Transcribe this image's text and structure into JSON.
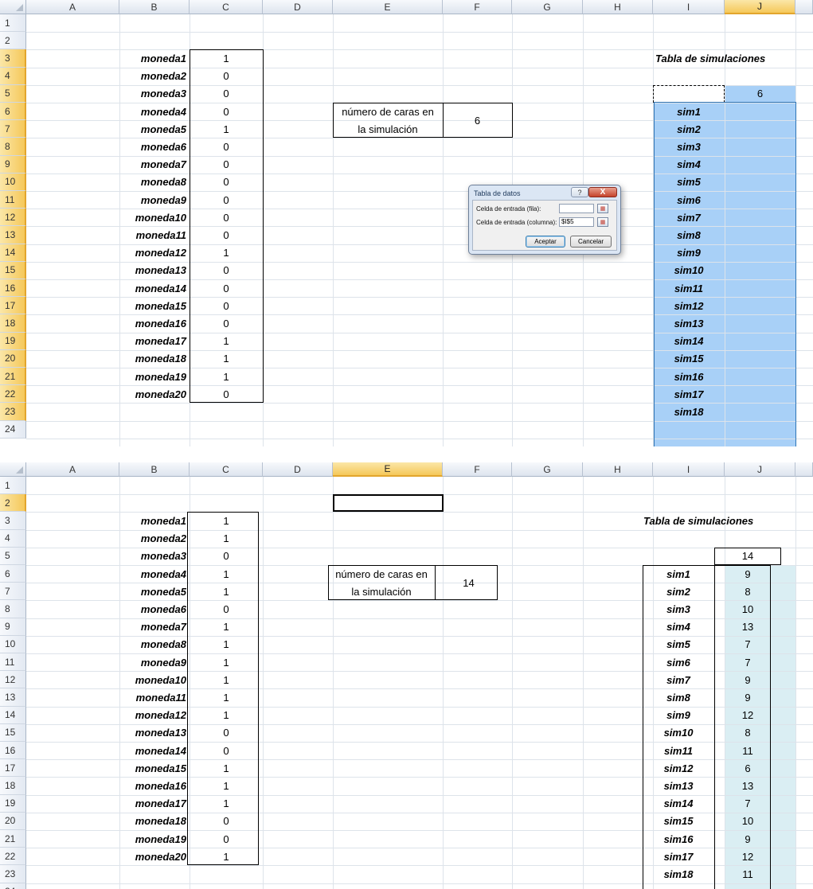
{
  "columns": [
    "A",
    "B",
    "C",
    "D",
    "E",
    "F",
    "G",
    "H",
    "I",
    "J"
  ],
  "row_numbers": [
    "1",
    "2",
    "3",
    "4",
    "5",
    "6",
    "7",
    "8",
    "9",
    "10",
    "11",
    "12",
    "13",
    "14",
    "15",
    "16",
    "17",
    "18",
    "19",
    "20",
    "21",
    "22",
    "23",
    "24"
  ],
  "label_box": {
    "line1": "número de caras en",
    "line2": "la simulación"
  },
  "sim_title": "Tabla de simulaciones",
  "coins": [
    "moneda1",
    "moneda2",
    "moneda3",
    "moneda4",
    "moneda5",
    "moneda6",
    "moneda7",
    "moneda8",
    "moneda9",
    "moneda10",
    "moneda11",
    "moneda12",
    "moneda13",
    "moneda14",
    "moneda15",
    "moneda16",
    "moneda17",
    "moneda18",
    "moneda19",
    "moneda20"
  ],
  "sims": [
    "sim1",
    "sim2",
    "sim3",
    "sim4",
    "sim5",
    "sim6",
    "sim7",
    "sim8",
    "sim9",
    "sim10",
    "sim11",
    "sim12",
    "sim13",
    "sim14",
    "sim15",
    "sim16",
    "sim17",
    "sim18"
  ],
  "sheet1": {
    "coin_values": [
      "1",
      "0",
      "0",
      "0",
      "1",
      "0",
      "0",
      "0",
      "0",
      "0",
      "0",
      "1",
      "0",
      "0",
      "0",
      "0",
      "1",
      "1",
      "1",
      "0"
    ],
    "heads_total": "6",
    "table_header": "6",
    "selected_column": "J",
    "selection_fill": "#a8d0f7",
    "dialog": {
      "title": "Tabla de datos",
      "help": "?",
      "close": "X",
      "row_input_label": "Celda de entrada (fila):",
      "row_input_value": "",
      "col_input_label": "Celda de entrada (columna):",
      "col_input_value": "$I$5",
      "ok": "Aceptar",
      "cancel": "Cancelar"
    }
  },
  "sheet2": {
    "coin_values": [
      "1",
      "1",
      "0",
      "1",
      "1",
      "0",
      "1",
      "1",
      "1",
      "1",
      "1",
      "1",
      "0",
      "0",
      "1",
      "1",
      "1",
      "0",
      "0",
      "1"
    ],
    "heads_total": "14",
    "table_header": "14",
    "sim_results": [
      "9",
      "8",
      "10",
      "13",
      "7",
      "7",
      "9",
      "9",
      "12",
      "8",
      "11",
      "6",
      "13",
      "7",
      "10",
      "9",
      "12",
      "11"
    ],
    "selected_column": "E",
    "result_fill": "#daeef3"
  }
}
